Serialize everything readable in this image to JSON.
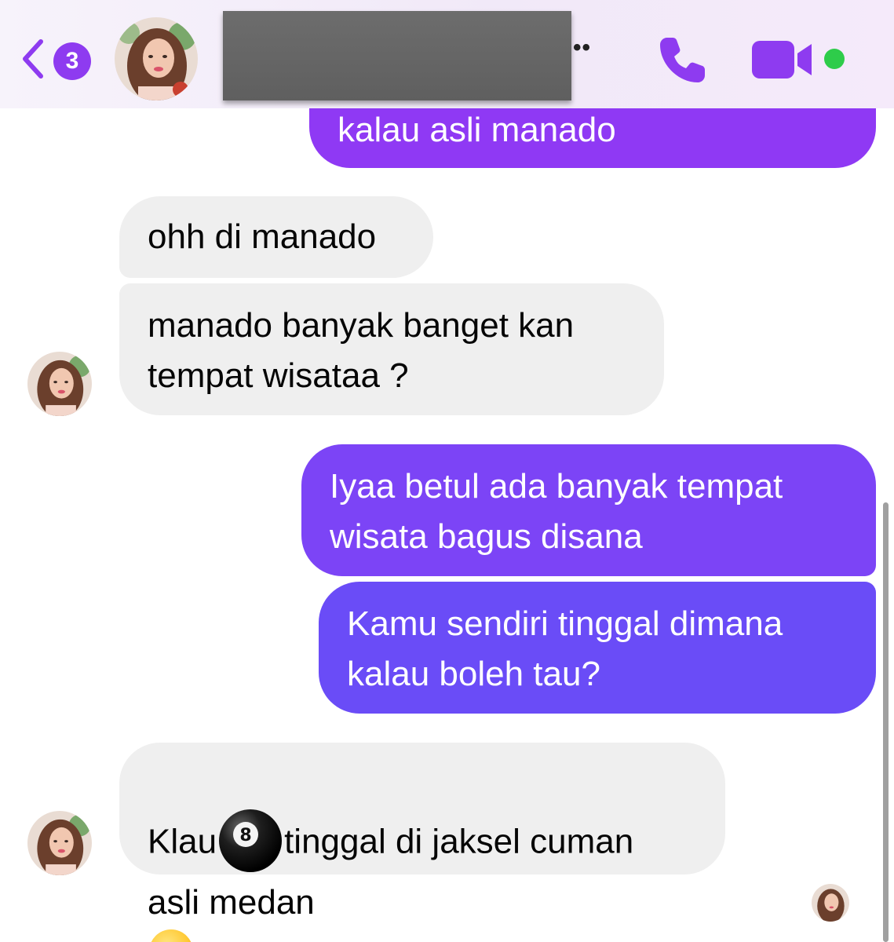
{
  "header": {
    "unread_count": "3",
    "contact_name_redacted": true,
    "dots": "••",
    "icons": {
      "back": "chevron-left-icon",
      "call": "phone-icon",
      "video": "video-camera-icon",
      "status": "online-status-dot"
    }
  },
  "messages": [
    {
      "direction": "outgoing",
      "text": "kalau asli manado"
    },
    {
      "direction": "incoming",
      "text": "ohh di manado"
    },
    {
      "direction": "incoming",
      "text": "manado banyak banget kan\ntempat wisataa ?"
    },
    {
      "direction": "outgoing",
      "text": "Iyaa betul ada banyak tempat\nwisata bagus disana"
    },
    {
      "direction": "outgoing",
      "text": "Kamu sendiri tinggal dimana\nkalau boleh tau?"
    },
    {
      "direction": "incoming",
      "text_part1": "Klau",
      "text_part2": "tinggal di jaksel cuman",
      "text_part3": "asli medan",
      "emoji_1": "8-ball-emoji",
      "emoji_2": "slightly-smiling-face-emoji"
    }
  ],
  "colors": {
    "accent": "#8e3bf0",
    "online": "#2ecc4a",
    "incoming_bubble": "#efefef",
    "outgoing_top": "#8f39f4",
    "outgoing_mid": "#7c44f6",
    "outgoing_bottom": "#6a4cf7"
  }
}
